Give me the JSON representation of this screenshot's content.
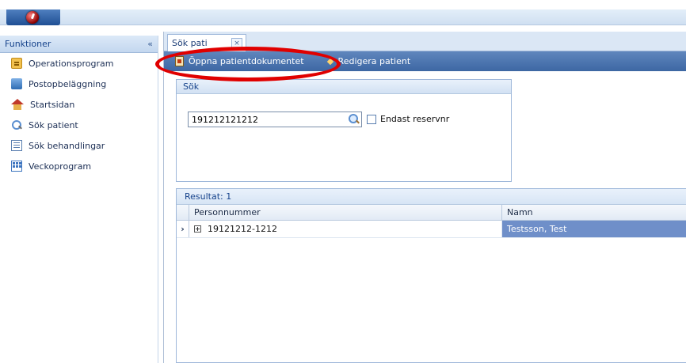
{
  "sidebar": {
    "title": "Funktioner",
    "collapse_label": "«",
    "items": [
      {
        "label": "Operationsprogram",
        "icon": "calendar-note-icon"
      },
      {
        "label": "Postopbeläggning",
        "icon": "people-icon"
      },
      {
        "label": "Startsidan",
        "icon": "home-icon"
      },
      {
        "label": "Sök patient",
        "icon": "search-icon"
      },
      {
        "label": "Sök behandlingar",
        "icon": "list-icon"
      },
      {
        "label": "Veckoprogram",
        "icon": "week-grid-icon"
      }
    ]
  },
  "tabs": [
    {
      "label": "Sök pati"
    }
  ],
  "toolbar": {
    "open_document_label": "Öppna patientdokumentet",
    "edit_patient_label": "Redigera patient"
  },
  "search": {
    "group_title": "Sök",
    "value": "191212121212",
    "reserve_only_label": "Endast reservnr",
    "reserve_only_checked": false
  },
  "results": {
    "title": "Resultat: 1",
    "columns": [
      "Personnummer",
      "Namn"
    ],
    "rows": [
      {
        "personnummer": "19121212-1212",
        "namn": "Testsson, Test",
        "selected": true
      }
    ]
  },
  "colors": {
    "toolbar": "#4a72ad",
    "selected_cell": "#6f8fc9",
    "annotation": "#e00000"
  }
}
